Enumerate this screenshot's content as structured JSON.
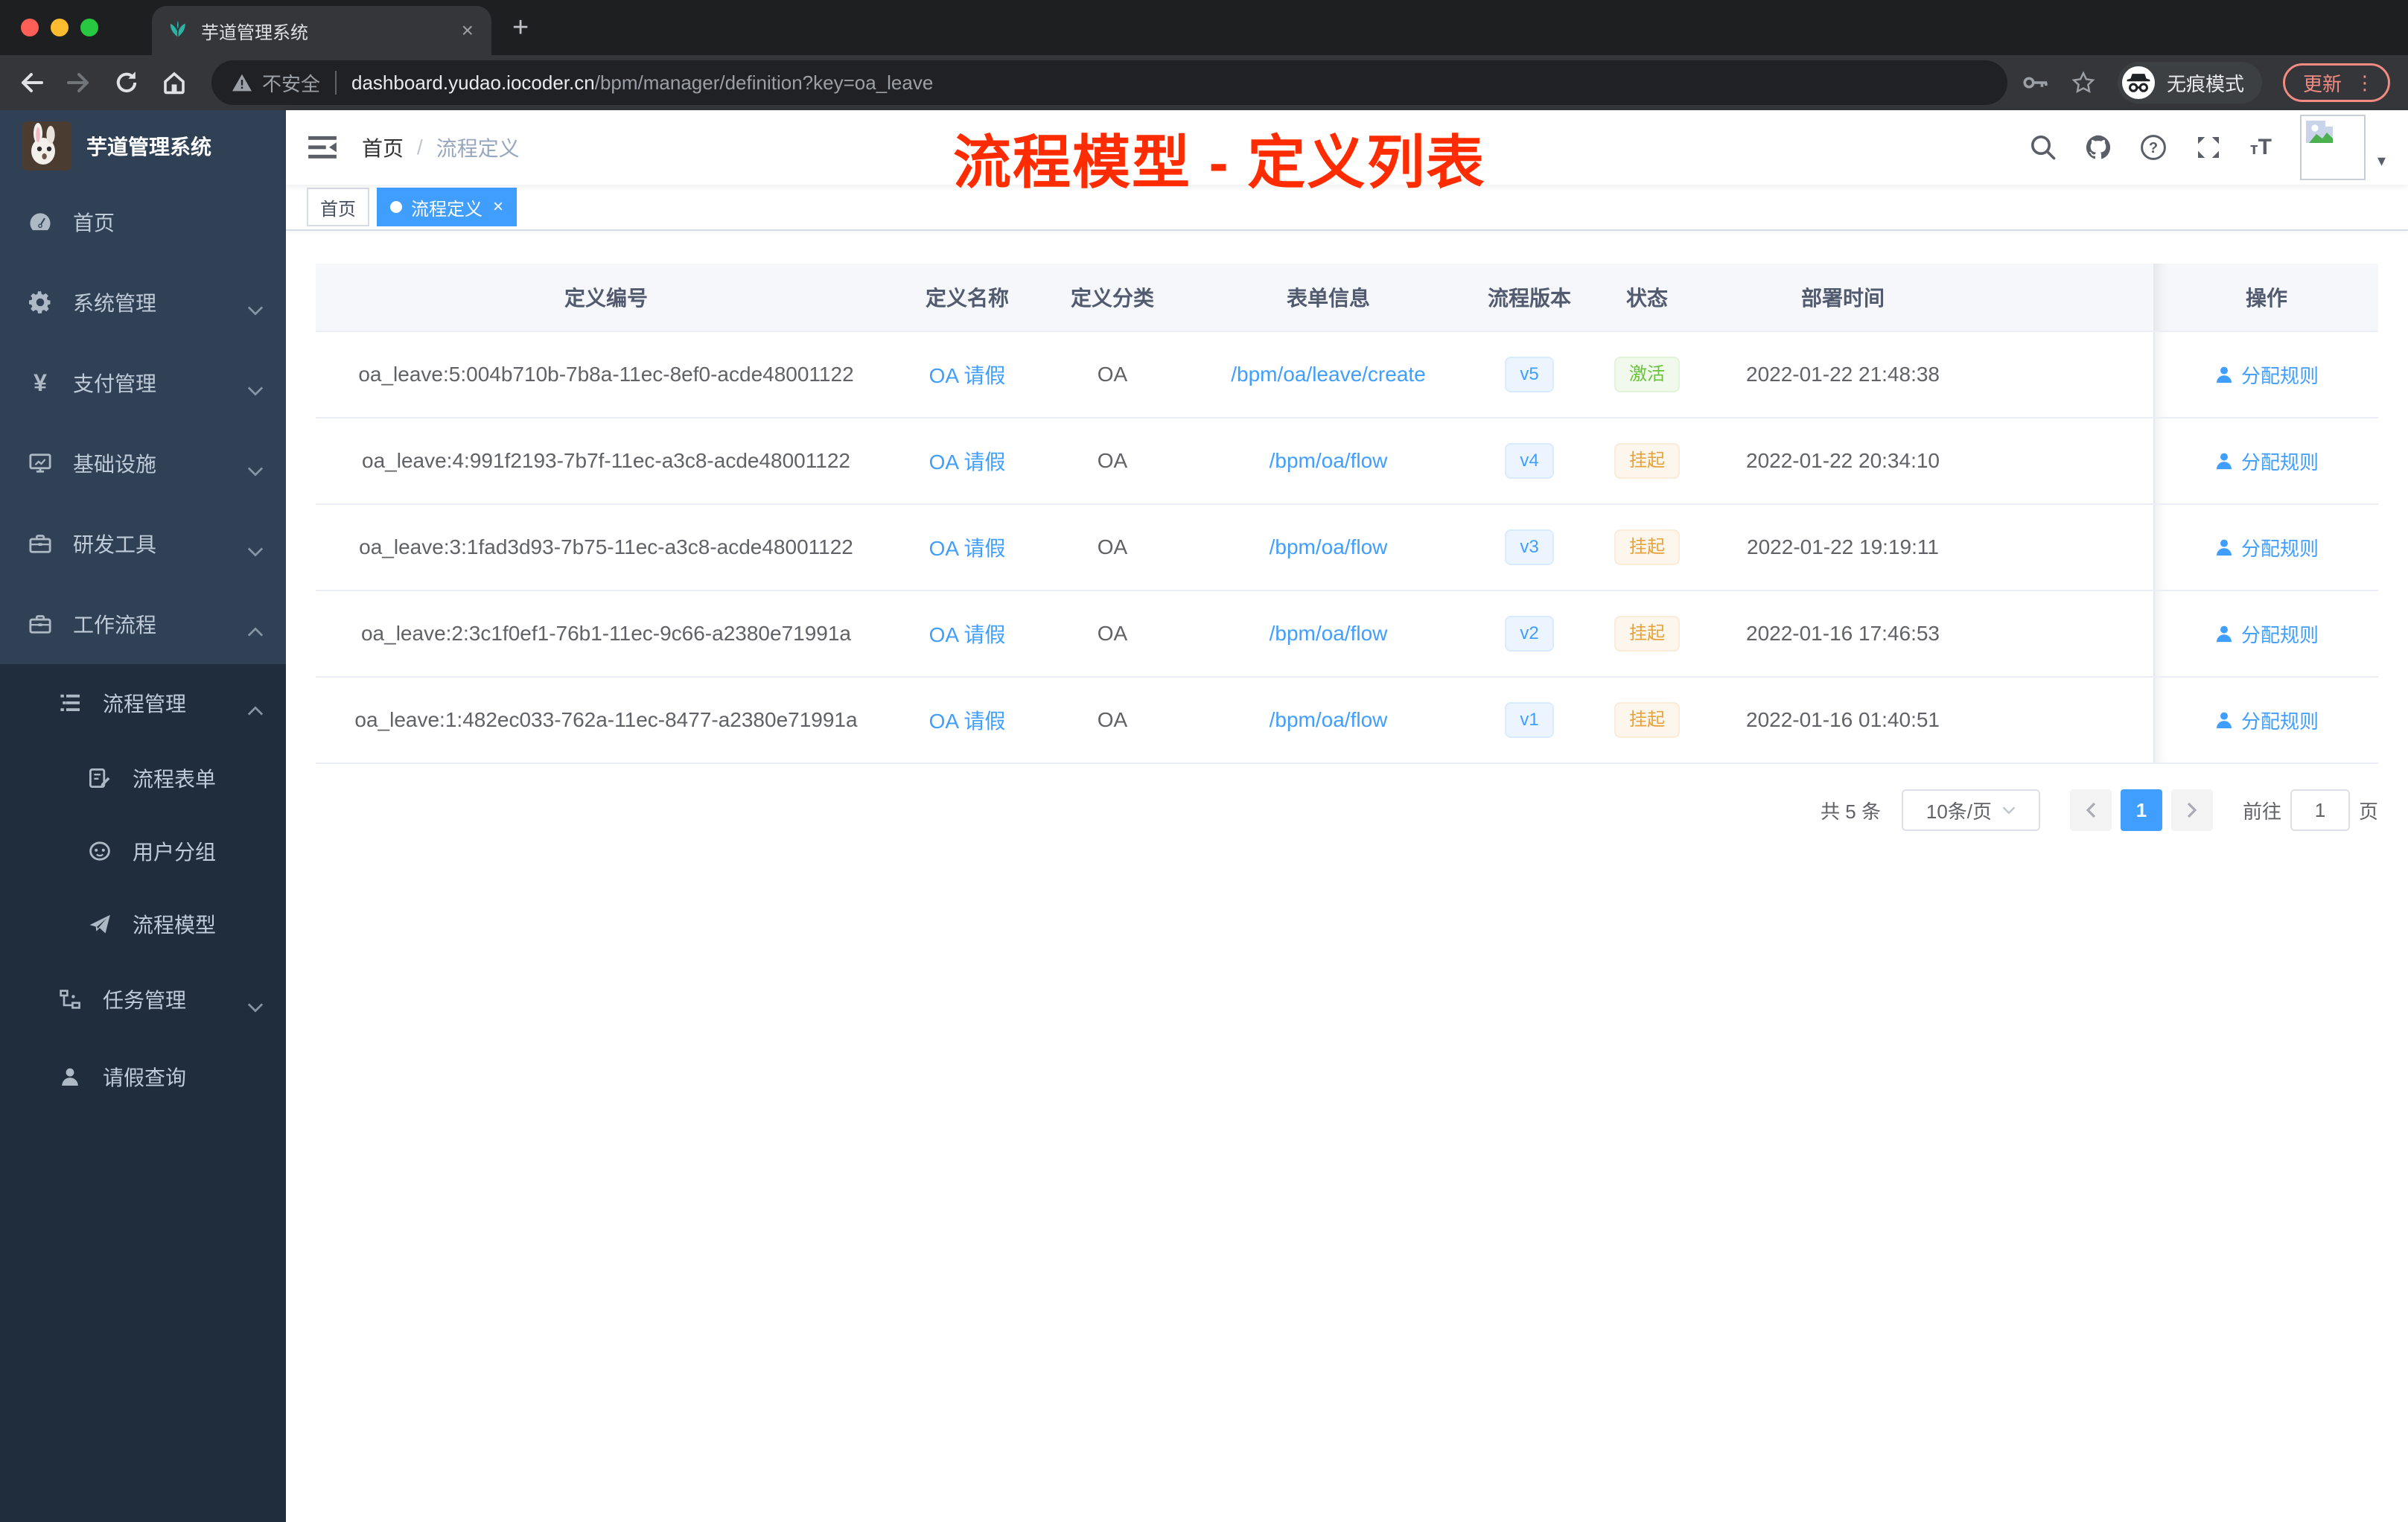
{
  "browser": {
    "tab_title": "芋道管理系统",
    "close_tab": "×",
    "new_tab": "+",
    "security_label": "不安全",
    "url_host": "dashboard.yudao.iocoder.cn",
    "url_path": "/bpm/manager/definition?key=oa_leave",
    "incognito_label": "无痕模式",
    "update_label": "更新",
    "menu_dots": "⋮"
  },
  "sidebar": {
    "title": "芋道管理系统",
    "items": [
      {
        "label": "首页",
        "icon": "dashboard",
        "level": 0,
        "group": false
      },
      {
        "label": "系统管理",
        "icon": "gear",
        "level": 0,
        "arrow": "down",
        "group": false
      },
      {
        "label": "支付管理",
        "icon": "yen",
        "level": 0,
        "arrow": "down",
        "group": false
      },
      {
        "label": "基础设施",
        "icon": "monitor",
        "level": 0,
        "arrow": "down",
        "group": false
      },
      {
        "label": "研发工具",
        "icon": "toolbox",
        "level": 0,
        "arrow": "down",
        "group": false
      },
      {
        "label": "工作流程",
        "icon": "toolbox",
        "level": 0,
        "arrow": "up",
        "group": false
      },
      {
        "label": "流程管理",
        "icon": "list-tree",
        "level": 1,
        "arrow": "up",
        "group": true
      },
      {
        "label": "流程表单",
        "icon": "doc-edit",
        "level": 2,
        "group": true
      },
      {
        "label": "用户分组",
        "icon": "face",
        "level": 2,
        "group": true
      },
      {
        "label": "流程模型",
        "icon": "send",
        "level": 2,
        "group": true
      },
      {
        "label": "任务管理",
        "icon": "org-tree",
        "level": 1,
        "arrow": "down",
        "group": true
      },
      {
        "label": "请假查询",
        "icon": "user",
        "level": 1,
        "group": true
      }
    ]
  },
  "header": {
    "breadcrumb_home": "首页",
    "breadcrumb_sep": "/",
    "breadcrumb_current": "流程定义",
    "annotation": "流程模型 - 定义列表"
  },
  "tags": [
    {
      "label": "首页",
      "active": false,
      "closable": false
    },
    {
      "label": "流程定义",
      "active": true,
      "closable": true
    }
  ],
  "table": {
    "columns": [
      "定义编号",
      "定义名称",
      "定义分类",
      "表单信息",
      "流程版本",
      "状态",
      "部署时间"
    ],
    "op_column": "操作",
    "action_label": "分配规则",
    "rows": [
      {
        "id": "oa_leave:5:004b710b-7b8a-11ec-8ef0-acde48001122",
        "name": "OA 请假",
        "category": "OA",
        "form": "/bpm/oa/leave/create",
        "version": "v5",
        "status": "激活",
        "status_type": "active",
        "deployed": "2022-01-22 21:48:38"
      },
      {
        "id": "oa_leave:4:991f2193-7b7f-11ec-a3c8-acde48001122",
        "name": "OA 请假",
        "category": "OA",
        "form": "/bpm/oa/flow",
        "version": "v4",
        "status": "挂起",
        "status_type": "suspend",
        "deployed": "2022-01-22 20:34:10"
      },
      {
        "id": "oa_leave:3:1fad3d93-7b75-11ec-a3c8-acde48001122",
        "name": "OA 请假",
        "category": "OA",
        "form": "/bpm/oa/flow",
        "version": "v3",
        "status": "挂起",
        "status_type": "suspend",
        "deployed": "2022-01-22 19:19:11"
      },
      {
        "id": "oa_leave:2:3c1f0ef1-76b1-11ec-9c66-a2380e71991a",
        "name": "OA 请假",
        "category": "OA",
        "form": "/bpm/oa/flow",
        "version": "v2",
        "status": "挂起",
        "status_type": "suspend",
        "deployed": "2022-01-16 17:46:53"
      },
      {
        "id": "oa_leave:1:482ec033-762a-11ec-8477-a2380e71991a",
        "name": "OA 请假",
        "category": "OA",
        "form": "/bpm/oa/flow",
        "version": "v1",
        "status": "挂起",
        "status_type": "suspend",
        "deployed": "2022-01-16 01:40:51"
      }
    ]
  },
  "pagination": {
    "total": "共 5 条",
    "page_size": "10条/页",
    "current": "1",
    "goto_label": "前往",
    "goto_value": "1",
    "page_unit": "页"
  },
  "colors": {
    "primary": "#409eff",
    "annotation_red": "#fe2c00",
    "sidebar_bg": "#304156",
    "submenu_bg": "#1f2d3d",
    "status_active": "#67c23a",
    "status_suspend": "#e6a23c"
  }
}
